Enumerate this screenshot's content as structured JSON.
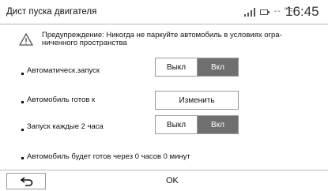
{
  "header": {
    "title": "Дист пуска двигателя",
    "temperature": "-- °F",
    "time": "16:45",
    "icons": [
      "signal-icon",
      "battery-icon"
    ]
  },
  "warning": {
    "icon": "warning-icon",
    "line1": "Предупреждение: Никогда не паркуйте автомобиль в условиях огра-",
    "line2": "ниченного пространства"
  },
  "settings": {
    "auto_start": {
      "label": "Автоматическ.запуск",
      "off": "Выкл",
      "on": "Вкл",
      "selected": "Вкл"
    },
    "ready_at": {
      "label": "Автомобиль готов к",
      "button": "Изменить"
    },
    "every_2h": {
      "label": "Запуск каждые 2 часа",
      "off": "Выкл",
      "on": "Вкл",
      "selected": "Вкл"
    }
  },
  "info": {
    "text": "Автомобиль будет готов через 0 часов 0 минут"
  },
  "footer": {
    "back_icon": "back-arrow-icon",
    "ok": "OK"
  }
}
